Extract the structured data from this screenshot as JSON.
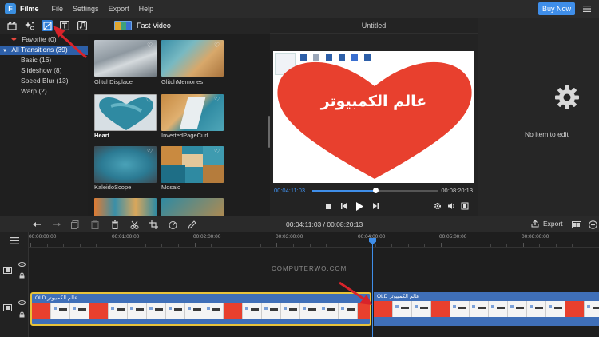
{
  "app": {
    "name": "Filme",
    "logo_letter": "F",
    "menu": [
      "File",
      "Settings",
      "Export",
      "Help"
    ],
    "buy_now": "Buy Now"
  },
  "media_tabs": {
    "icons": [
      "media-icon",
      "effects-icon",
      "transitions-icon",
      "text-icon",
      "music-icon"
    ],
    "fast_video_label": "Fast Video"
  },
  "tree": {
    "favorite": "Favorite (0)",
    "all_transitions": "All Transitions (39)",
    "items": [
      "Basic (16)",
      "Slideshow (8)",
      "Speed Blur (13)",
      "Warp (2)"
    ]
  },
  "transitions": [
    {
      "label": "GlitchDisplace"
    },
    {
      "label": "GlitchMemories"
    },
    {
      "label": "Heart"
    },
    {
      "label": "InvertedPageCurl"
    },
    {
      "label": "KaleidoScope"
    },
    {
      "label": "Mosaic"
    },
    {
      "label": ""
    },
    {
      "label": ""
    }
  ],
  "preview": {
    "title": "Untitled",
    "arabic_text": "عالم الكمبيوتر",
    "current_time": "00:04:11:03",
    "total_time": "00:08:20:13",
    "progress_fraction": 0.5
  },
  "properties": {
    "empty_text": "No item to edit"
  },
  "toolbar": {
    "timecode": "00:04:11:03 / 00:08:20:13",
    "export_label": "Export"
  },
  "timeline": {
    "ruler": [
      "00:00:00:00",
      "00:01:00:00",
      "00:02:00:00",
      "00:03:00:00",
      "00:04:00:00",
      "00:05:00:00",
      "00:06:00:00"
    ],
    "watermark": "COMPUTERWO.COM",
    "clip1_title": "OLD عالم الكمبيوتر",
    "clip2_title": "OLD عالم الكمبيوتر"
  }
}
